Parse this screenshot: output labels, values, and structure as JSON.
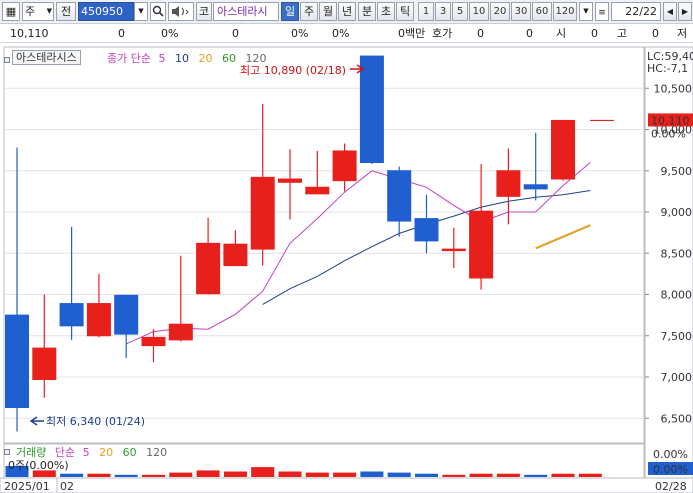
{
  "toolbar": {
    "market_select": "주",
    "chart_type": "전",
    "stock_code": "450950",
    "dropdown_arrow": "▼",
    "sound_icon": "speaker-icon",
    "stock_name_prefix": "코",
    "stock_name": "아스테라시",
    "periods": [
      "일",
      "주",
      "월",
      "년",
      "분",
      "초",
      "틱"
    ],
    "active_period": "일",
    "intervals": [
      "1",
      "3",
      "5",
      "10",
      "20",
      "30",
      "60",
      "120"
    ],
    "page_counter": "22/22"
  },
  "infobar": {
    "price": "10,110",
    "change": "0",
    "change_rate": "0%",
    "volume": "0",
    "volume_rate": "0%",
    "amount": "0",
    "amount_rate": "0%",
    "amount_unit": "0백만",
    "bid_label": "호가",
    "bid_value": "0",
    "bid_change": "0",
    "open_label": "시",
    "open_value": "0",
    "high_label": "고",
    "high_value": "0",
    "low_label": "저"
  },
  "main_chart": {
    "indicator_title": "아스테라시스",
    "legend_label": "종가 단순",
    "ma_periods": [
      "5",
      "10",
      "20",
      "60",
      "120"
    ],
    "ma_colors": [
      "#c040c0",
      "#1f3d8f",
      "#e0a020",
      "#2a9a2a",
      "#444444"
    ],
    "high_annotation": "최고 10,890 (02/18)",
    "low_annotation": "최저 6,340 (01/24)",
    "lc_label": "LC:59,40",
    "hc_label": "HC:-7,1",
    "current_price_label": "10,110",
    "current_rate_label": "0.00%"
  },
  "volume_chart": {
    "title": "거래량",
    "legend_label": "단순",
    "ma_periods": [
      "5",
      "20",
      "60",
      "120"
    ],
    "ma_colors": [
      "#c040c0",
      "#e0a020",
      "#2a9a2a",
      "#444444"
    ],
    "value_label": "0주(0.00%)",
    "axis_value_label": "0.00%",
    "axis_label_top": "0.00%"
  },
  "x_axis": {
    "labels": [
      "2025/01",
      "02"
    ],
    "right_label": "02/28"
  },
  "colors": {
    "up": "#e8201c",
    "down": "#1f5fd0",
    "ma5": "#c040c0",
    "ma10": "#1f3d8f",
    "ma20": "#e0a020",
    "current_price_bg": "#e8201c"
  },
  "chart_data": {
    "type": "candlestick",
    "y_ticks": [
      6500,
      7000,
      7500,
      8000,
      8500,
      9000,
      9500,
      10000,
      10500
    ],
    "ylim": [
      6200,
      11000
    ],
    "candles": [
      {
        "open": 7750,
        "high": 9780,
        "low": 6340,
        "close": 6630
      },
      {
        "open": 6970,
        "high": 8000,
        "low": 6750,
        "close": 7350
      },
      {
        "open": 7890,
        "high": 8820,
        "low": 7450,
        "close": 7620
      },
      {
        "open": 7500,
        "high": 8250,
        "low": 7480,
        "close": 7890
      },
      {
        "open": 7990,
        "high": 7990,
        "low": 7230,
        "close": 7520
      },
      {
        "open": 7380,
        "high": 7580,
        "low": 7180,
        "close": 7480
      },
      {
        "open": 7450,
        "high": 8470,
        "low": 7430,
        "close": 7640
      },
      {
        "open": 8010,
        "high": 8930,
        "low": 8000,
        "close": 8620
      },
      {
        "open": 8350,
        "high": 8780,
        "low": 8350,
        "close": 8610
      },
      {
        "open": 8550,
        "high": 10310,
        "low": 8350,
        "close": 9420
      },
      {
        "open": 9360,
        "high": 9760,
        "low": 8910,
        "close": 9400
      },
      {
        "open": 9220,
        "high": 9740,
        "low": 9220,
        "close": 9300
      },
      {
        "open": 9380,
        "high": 9830,
        "low": 9250,
        "close": 9740
      },
      {
        "open": 10890,
        "high": 10890,
        "low": 9580,
        "close": 9600
      },
      {
        "open": 9500,
        "high": 9550,
        "low": 8700,
        "close": 8890
      },
      {
        "open": 8920,
        "high": 9210,
        "low": 8500,
        "close": 8650
      },
      {
        "open": 8550,
        "high": 8810,
        "low": 8320,
        "close": 8550
      },
      {
        "open": 8200,
        "high": 9580,
        "low": 8060,
        "close": 9010
      },
      {
        "open": 9190,
        "high": 9770,
        "low": 8850,
        "close": 9500
      },
      {
        "open": 9330,
        "high": 9960,
        "low": 9140,
        "close": 9280
      },
      {
        "open": 9400,
        "high": 10110,
        "low": 9380,
        "close": 10110
      },
      {
        "open": 10110,
        "high": 10110,
        "low": 10110,
        "close": 10110
      }
    ],
    "ma5": [
      null,
      null,
      null,
      null,
      7400,
      7550,
      7590,
      7580,
      7760,
      8040,
      8620,
      8920,
      9240,
      9500,
      9400,
      9300,
      9080,
      8880,
      9000,
      9000,
      9320,
      9600
    ],
    "ma10": [
      null,
      null,
      null,
      null,
      null,
      null,
      null,
      null,
      null,
      7880,
      8070,
      8220,
      8410,
      8580,
      8740,
      8850,
      8950,
      9060,
      9130,
      9180,
      9210,
      9260
    ],
    "ma20": [
      null,
      null,
      null,
      null,
      null,
      null,
      null,
      null,
      null,
      null,
      null,
      null,
      null,
      null,
      null,
      null,
      null,
      null,
      null,
      8560,
      8700,
      8840
    ],
    "volume": [
      10,
      6,
      3,
      3,
      2,
      2,
      4,
      6,
      5,
      9,
      5,
      4,
      4,
      5,
      4,
      3,
      2,
      3,
      3,
      2,
      3,
      3
    ]
  }
}
